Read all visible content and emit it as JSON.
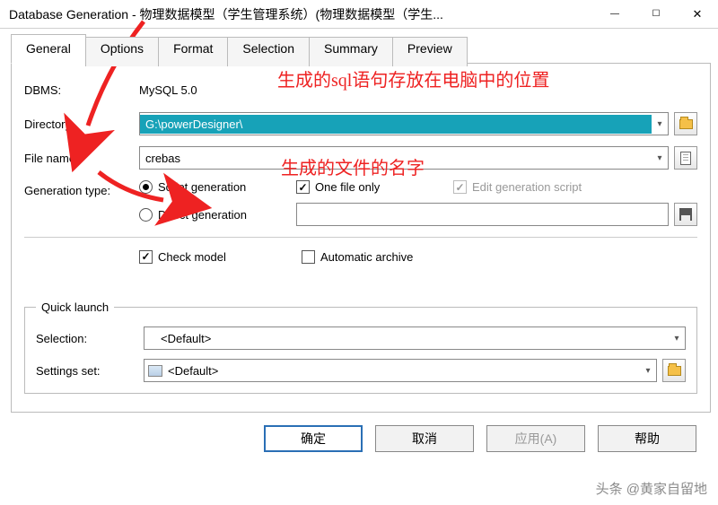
{
  "window": {
    "title": "Database Generation - 物理数据模型（学生管理系统）(物理数据模型（学生..."
  },
  "tabs": [
    "General",
    "Options",
    "Format",
    "Selection",
    "Summary",
    "Preview"
  ],
  "fields": {
    "dbms_label": "DBMS:",
    "dbms_value": "MySQL 5.0",
    "directory_label": "Directory:",
    "directory_value": "G:\\powerDesigner\\",
    "filename_label": "File name:",
    "filename_value": "crebas",
    "gentype_label": "Generation type:",
    "radio_script": "Script generation",
    "radio_direct": "Direct generation",
    "check_onefile": "One file only",
    "check_editscript": "Edit generation script",
    "check_model": "Check model",
    "check_archive": "Automatic archive"
  },
  "quicklaunch": {
    "legend": "Quick launch",
    "selection_label": "Selection:",
    "selection_value": "<Default>",
    "settings_label": "Settings set:",
    "settings_value": "<Default>"
  },
  "buttons": {
    "ok": "确定",
    "cancel": "取消",
    "apply": "应用(A)",
    "help": "帮助"
  },
  "annotations": {
    "a1": "生成的sql语句存放在电脑中的位置",
    "a2": "生成的文件的名字"
  },
  "watermark": "头条 @黄家自留地"
}
